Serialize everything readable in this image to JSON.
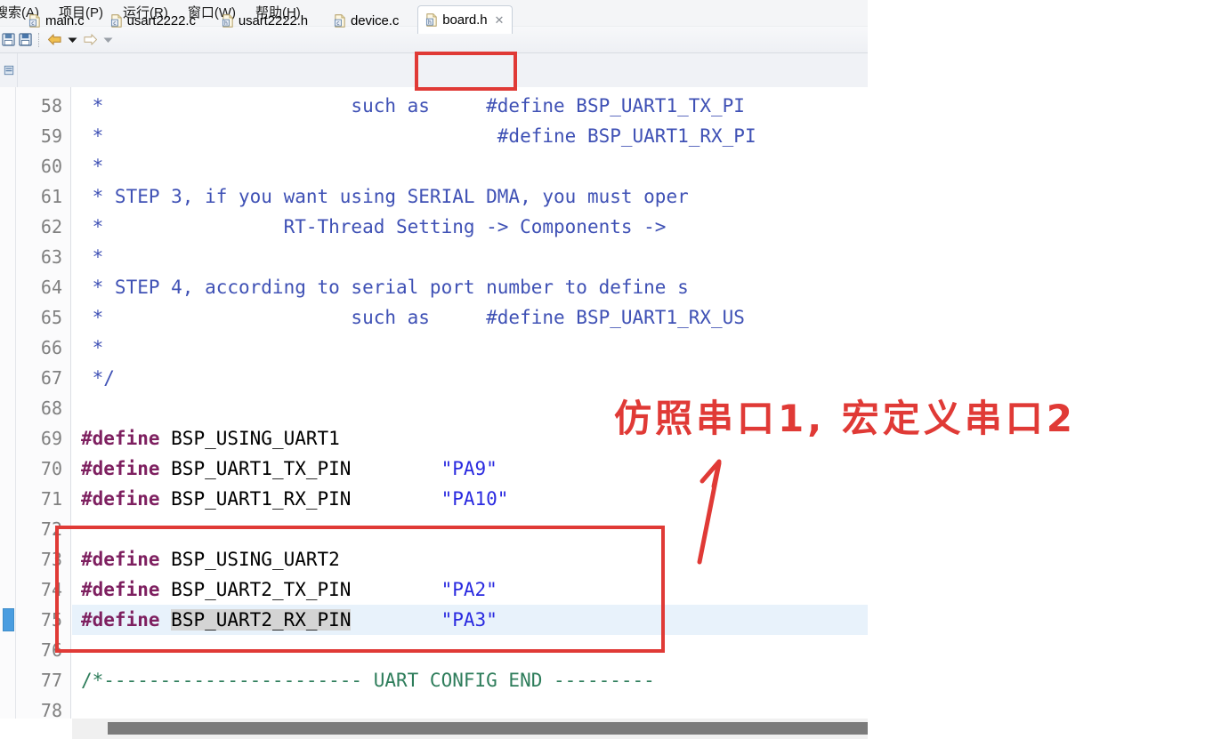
{
  "app": {
    "type": "eclipse-ide-code-editor"
  },
  "menubar": {
    "items": [
      {
        "label": "搜索(A)",
        "name": "menu-search"
      },
      {
        "label": "项目(P)",
        "name": "menu-project"
      },
      {
        "label": "运行(R)",
        "name": "menu-run"
      },
      {
        "label": "窗口(W)",
        "name": "menu-window"
      },
      {
        "label": "帮助(H)",
        "name": "menu-help"
      }
    ]
  },
  "toolbar": {
    "items": [
      {
        "icon": "save-icon"
      },
      {
        "icon": "save-all-icon"
      },
      {
        "icon": "back-arrow-icon"
      },
      {
        "icon": "back-dropdown-icon"
      },
      {
        "icon": "forward-arrow-icon"
      },
      {
        "icon": "forward-dropdown-icon"
      }
    ]
  },
  "tabs": {
    "items": [
      {
        "label": "main.c",
        "kind": "c",
        "active": false
      },
      {
        "label": "usart2222.c",
        "kind": "c",
        "active": false
      },
      {
        "label": "usart2222.h",
        "kind": "h",
        "active": false
      },
      {
        "label": "device.c",
        "kind": "c",
        "active": false
      },
      {
        "label": "board.h",
        "kind": "h",
        "active": true
      }
    ],
    "close_glyph": "✕"
  },
  "editor": {
    "active_file": "board.h",
    "current_line": 75,
    "selection_text": "BSP_UART2_RX_PIN",
    "first_visible_line": 58,
    "last_visible_line": 78,
    "lines": [
      {
        "n": 58,
        "segs": [
          {
            "t": " *                      such as     #define BSP_UART1_TX_PI",
            "c": "tok-comment"
          }
        ]
      },
      {
        "n": 59,
        "segs": [
          {
            "t": " *                                   #define BSP_UART1_RX_PI",
            "c": "tok-comment"
          }
        ]
      },
      {
        "n": 60,
        "segs": [
          {
            "t": " *",
            "c": "tok-comment"
          }
        ]
      },
      {
        "n": 61,
        "segs": [
          {
            "t": " * STEP 3, if you want using SERIAL DMA, you must oper",
            "c": "tok-comment"
          }
        ]
      },
      {
        "n": 62,
        "segs": [
          {
            "t": " *                RT-Thread Setting -> Components ->",
            "c": "tok-comment"
          }
        ]
      },
      {
        "n": 63,
        "segs": [
          {
            "t": " *",
            "c": "tok-comment"
          }
        ]
      },
      {
        "n": 64,
        "segs": [
          {
            "t": " * STEP 4, according to serial port number to define s",
            "c": "tok-comment"
          }
        ]
      },
      {
        "n": 65,
        "segs": [
          {
            "t": " *                      such as     #define BSP_UART1_RX_US",
            "c": "tok-comment"
          }
        ]
      },
      {
        "n": 66,
        "segs": [
          {
            "t": " *",
            "c": "tok-comment"
          }
        ]
      },
      {
        "n": 67,
        "segs": [
          {
            "t": " */",
            "c": "tok-comment"
          }
        ]
      },
      {
        "n": 68,
        "segs": []
      },
      {
        "n": 69,
        "segs": [
          {
            "t": "#define",
            "c": "tok-kw"
          },
          {
            "t": " BSP_USING_UART1",
            "c": "tok-plain"
          }
        ]
      },
      {
        "n": 70,
        "segs": [
          {
            "t": "#define",
            "c": "tok-kw"
          },
          {
            "t": " BSP_UART1_TX_PIN        ",
            "c": "tok-plain"
          },
          {
            "t": "\"PA9\"",
            "c": "tok-str"
          }
        ]
      },
      {
        "n": 71,
        "segs": [
          {
            "t": "#define",
            "c": "tok-kw"
          },
          {
            "t": " BSP_UART1_RX_PIN        ",
            "c": "tok-plain"
          },
          {
            "t": "\"PA10\"",
            "c": "tok-str"
          }
        ]
      },
      {
        "n": 72,
        "segs": []
      },
      {
        "n": 73,
        "segs": [
          {
            "t": "#define",
            "c": "tok-kw"
          },
          {
            "t": " BSP_USING_UART2",
            "c": "tok-plain"
          }
        ]
      },
      {
        "n": 74,
        "segs": [
          {
            "t": "#define",
            "c": "tok-kw"
          },
          {
            "t": " BSP_UART2_TX_PIN        ",
            "c": "tok-plain"
          },
          {
            "t": "\"PA2\"",
            "c": "tok-str"
          }
        ]
      },
      {
        "n": 75,
        "hl": true,
        "segs": [
          {
            "t": "#define",
            "c": "tok-kw"
          },
          {
            "t": " ",
            "c": "tok-plain"
          },
          {
            "t": "BSP_UART2_RX_PIN",
            "c": "tok-plain sel-box"
          },
          {
            "t": "        ",
            "c": "tok-plain"
          },
          {
            "t": "\"PA3\"",
            "c": "tok-str"
          }
        ]
      },
      {
        "n": 76,
        "segs": []
      },
      {
        "n": 77,
        "segs": [
          {
            "t": "/*----------------------- UART CONFIG END ---------",
            "c": "tok-comment-green"
          }
        ]
      },
      {
        "n": 78,
        "segs": []
      }
    ]
  },
  "annotations": {
    "note_text": "仿照串口1, 宏定义串口2",
    "color": "#e03a36",
    "box_label": "uart2-define-highlight-box",
    "tab_box_label": "board-h-tab-highlight-box",
    "arrow_label": "red-arrow-pointing-to-note"
  },
  "scrollbar": {
    "orientation": "horizontal"
  }
}
